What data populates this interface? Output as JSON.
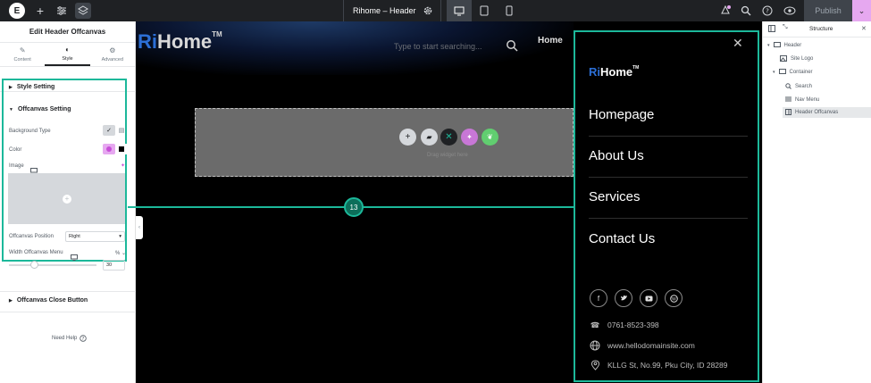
{
  "topbar": {
    "page_title": "Rihome – Header",
    "publish_label": "Publish"
  },
  "left_panel": {
    "title": "Edit Header Offcanvas",
    "tabs": [
      {
        "label": "Content",
        "icon": "pencil-icon"
      },
      {
        "label": "Style",
        "icon": "half-circle-icon"
      },
      {
        "label": "Advanced",
        "icon": "gear-icon"
      }
    ],
    "style_setting_label": "Style Setting",
    "offcanvas_setting_label": "Offcanvas Setting",
    "background_type_label": "Background Type",
    "color_label": "Color",
    "image_label": "Image",
    "position_label": "Offcanvas Position",
    "position_value": "Right",
    "width_label": "Width Offcanvas Menu",
    "width_unit": "% ⌄",
    "width_value": "30",
    "close_button_label": "Offcanvas Close Button",
    "need_help_label": "Need Help",
    "accent_color": "#1cb89a",
    "selected_color": "#e6a8f0"
  },
  "canvas": {
    "brand_ri": "Ri",
    "brand_rest": "Home",
    "brand_tm": "TM",
    "search_placeholder": "Type to start searching...",
    "nav_home": "Home",
    "drop_text": "Drag widget here",
    "badge_number": "13"
  },
  "offcanvas": {
    "brand_ri": "Ri",
    "brand_rest": "Home",
    "brand_tm": "TM",
    "menu": [
      "Homepage",
      "About Us",
      "Services",
      "Contact Us"
    ],
    "socials": [
      "facebook-icon",
      "twitter-icon",
      "youtube-icon",
      "wordpress-icon"
    ],
    "phone": "0761-8523-398",
    "website": "www.hellodomainsite.com",
    "address": "KLLG St, No.99, Pku City, ID 28289"
  },
  "right_panel": {
    "title": "Structure",
    "tree": [
      {
        "label": "Header"
      },
      {
        "label": "Site Logo"
      },
      {
        "label": "Container"
      },
      {
        "label": "Search"
      },
      {
        "label": "Nav Menu"
      },
      {
        "label": "Header Offcanvas"
      }
    ]
  }
}
